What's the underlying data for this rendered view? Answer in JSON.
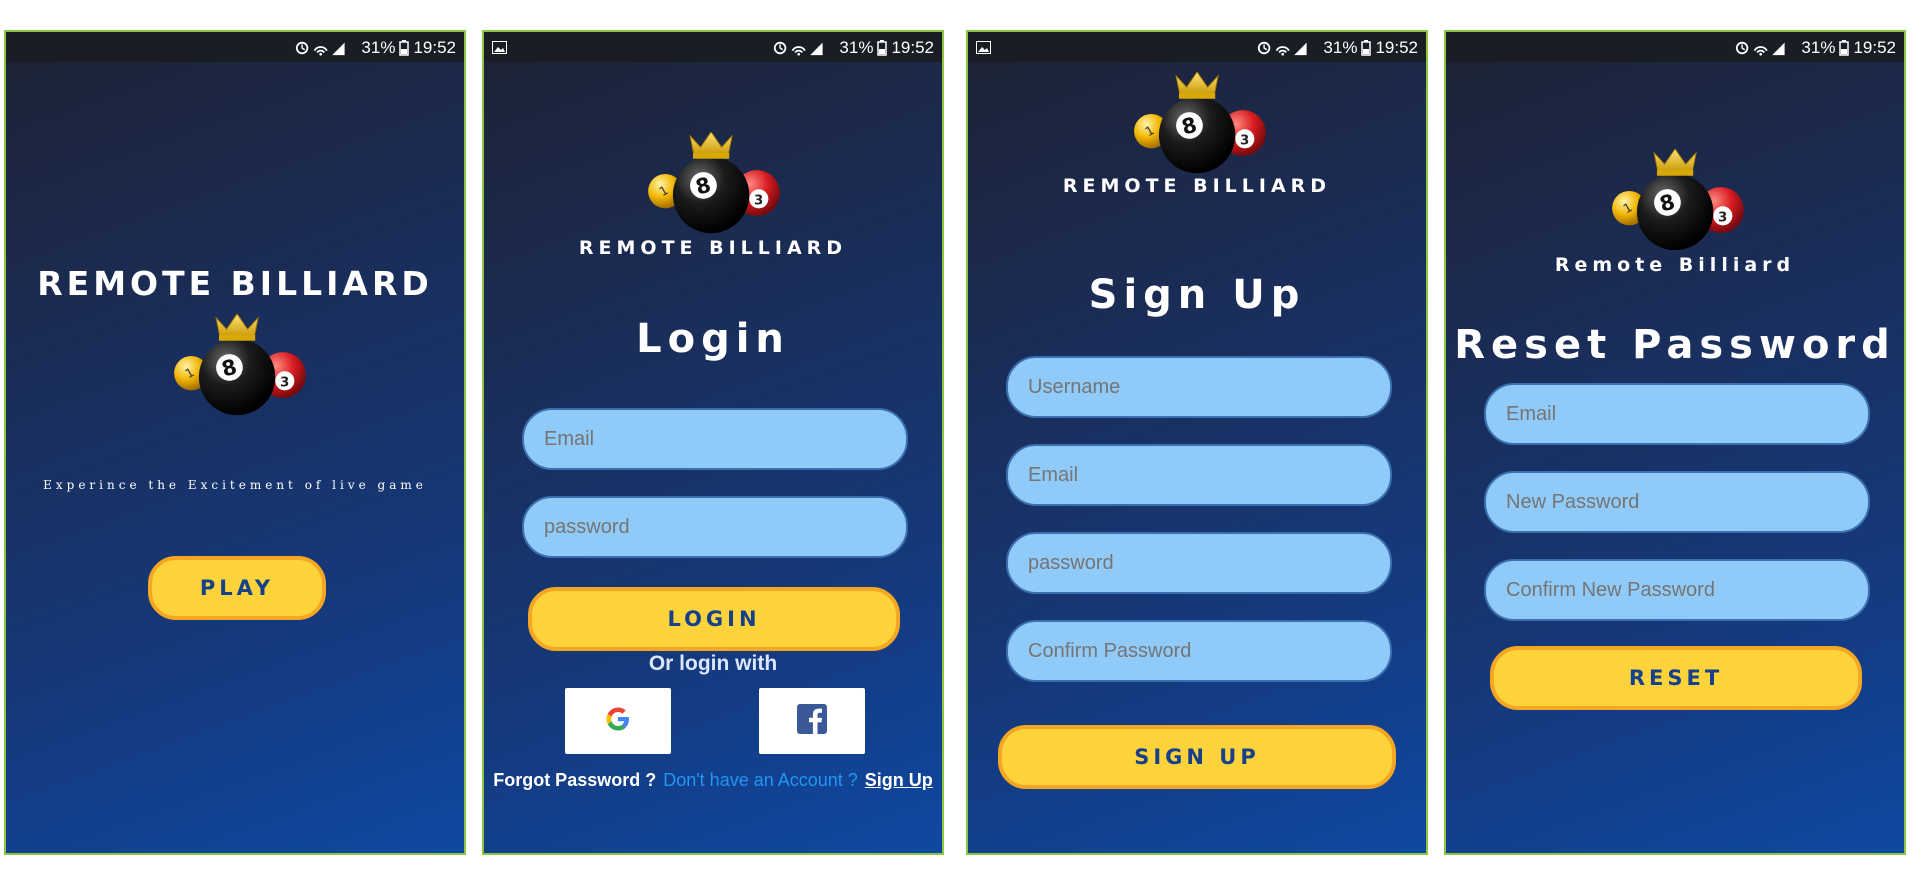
{
  "status_bar": {
    "battery": "31%",
    "time": "19:52"
  },
  "brand": {
    "title": "Remote Billiard"
  },
  "colors": {
    "accent": "#fdd33c",
    "field_bg": "#90caf9",
    "button_text": "#16418a",
    "link": "#2196f3",
    "frame": "#8cc63f"
  },
  "icons": [
    "alarm-icon",
    "wifi-icon",
    "signal-icon",
    "battery-icon",
    "gallery-icon",
    "billiard-logo-icon",
    "google-icon",
    "facebook-icon"
  ],
  "splash": {
    "tagline": "Experince the Excitement of live game",
    "play_label": "PLAY"
  },
  "login": {
    "title": "Login",
    "email_placeholder": "Email",
    "password_placeholder": "password",
    "login_label": "LOGIN",
    "or_text": "Or login with",
    "forgot_label": "Forgot Password ?",
    "no_account_text": "Don't have an Account ?",
    "signup_link": "Sign Up"
  },
  "signup": {
    "title": "Sign Up",
    "username_placeholder": "Username",
    "email_placeholder": "Email",
    "password_placeholder": "password",
    "confirm_placeholder": "Confirm Password",
    "signup_label": "SIGN UP"
  },
  "reset": {
    "title": "Reset Password",
    "email_placeholder": "Email",
    "new_password_placeholder": "New Password",
    "confirm_new_placeholder": "Confirm New Password",
    "reset_label": "RESET"
  }
}
